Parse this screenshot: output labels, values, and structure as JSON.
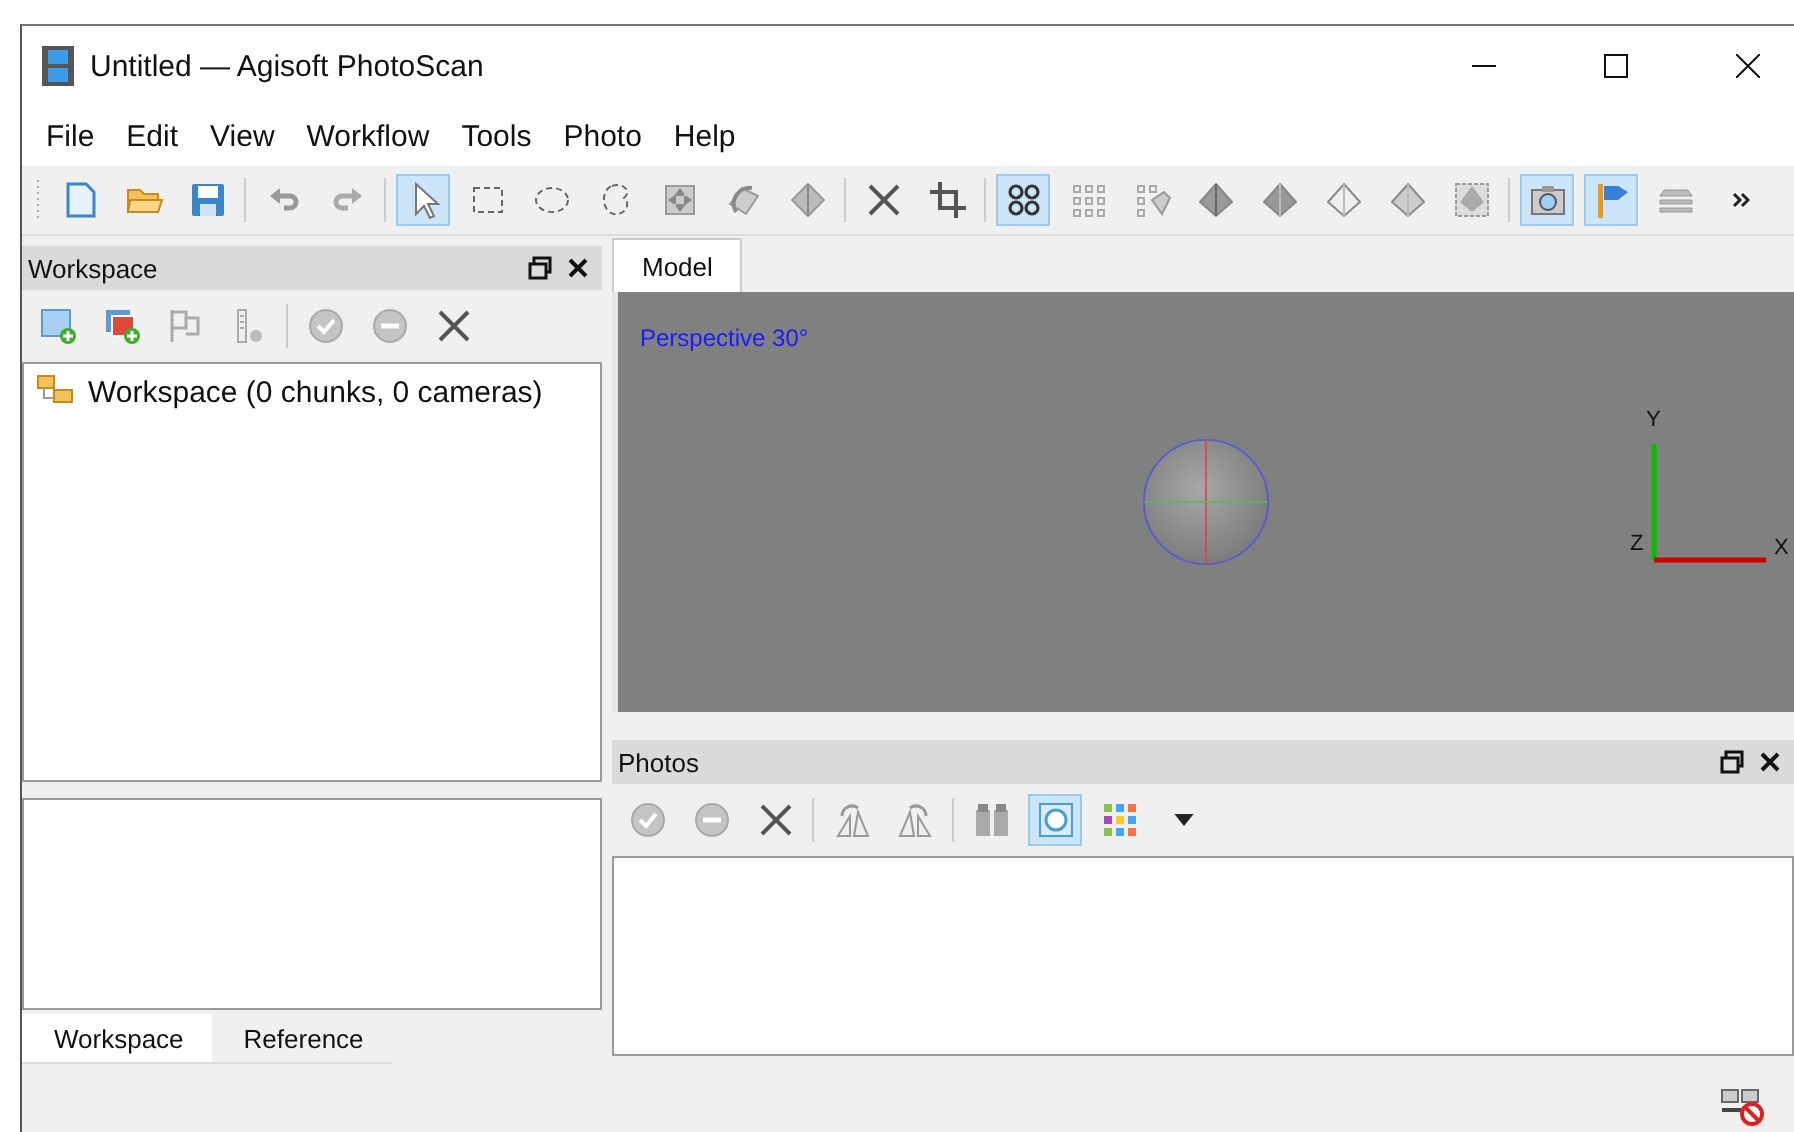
{
  "window": {
    "title": "Untitled — Agisoft PhotoScan"
  },
  "menu": [
    "File",
    "Edit",
    "View",
    "Workflow",
    "Tools",
    "Photo",
    "Help"
  ],
  "toolbar": [
    {
      "kind": "new",
      "selected": false
    },
    {
      "kind": "open",
      "selected": false
    },
    {
      "kind": "save",
      "selected": false
    },
    {
      "kind": "separator"
    },
    {
      "kind": "undo",
      "selected": false
    },
    {
      "kind": "redo",
      "selected": false
    },
    {
      "kind": "separator"
    },
    {
      "kind": "pointer",
      "selected": true
    },
    {
      "kind": "rect-select",
      "selected": false
    },
    {
      "kind": "circle-select",
      "selected": false
    },
    {
      "kind": "free-select",
      "selected": false
    },
    {
      "kind": "move",
      "selected": false
    },
    {
      "kind": "rotate",
      "selected": false
    },
    {
      "kind": "scale",
      "selected": false
    },
    {
      "kind": "separator"
    },
    {
      "kind": "delete",
      "selected": false
    },
    {
      "kind": "crop",
      "selected": false
    },
    {
      "kind": "separator"
    },
    {
      "kind": "points",
      "selected": true
    },
    {
      "kind": "dense",
      "selected": false
    },
    {
      "kind": "tagged",
      "selected": false
    },
    {
      "kind": "solid",
      "selected": false
    },
    {
      "kind": "shaded",
      "selected": false
    },
    {
      "kind": "wire",
      "selected": false
    },
    {
      "kind": "textured",
      "selected": false
    },
    {
      "kind": "tiled",
      "selected": false
    },
    {
      "kind": "separator"
    },
    {
      "kind": "camera",
      "selected": true
    },
    {
      "kind": "flag",
      "selected": true
    },
    {
      "kind": "layers",
      "selected": false
    },
    {
      "kind": "more",
      "selected": false
    }
  ],
  "workspace_panel": {
    "title": "Workspace",
    "toolbar": [
      {
        "kind": "add-photo"
      },
      {
        "kind": "add-chunk"
      },
      {
        "kind": "align"
      },
      {
        "kind": "ruler"
      },
      {
        "kind": "separator"
      },
      {
        "kind": "enable"
      },
      {
        "kind": "disable"
      },
      {
        "kind": "remove"
      }
    ],
    "tree": [
      {
        "label": "Workspace (0 chunks, 0 cameras)"
      }
    ]
  },
  "bottom_tabs": [
    {
      "label": "Workspace",
      "selected": true
    },
    {
      "label": "Reference",
      "selected": false
    }
  ],
  "model_tabs": [
    {
      "label": "Model",
      "selected": true
    }
  ],
  "viewport": {
    "label": "Perspective 30°",
    "axes": {
      "y": "Y",
      "z": "Z",
      "x": "X"
    }
  },
  "photos_panel": {
    "title": "Photos",
    "toolbar": [
      {
        "kind": "enable",
        "selected": false
      },
      {
        "kind": "disable",
        "selected": false
      },
      {
        "kind": "remove",
        "selected": false
      },
      {
        "kind": "separator"
      },
      {
        "kind": "rotate-right",
        "selected": false
      },
      {
        "kind": "rotate-left",
        "selected": false
      },
      {
        "kind": "separator"
      },
      {
        "kind": "binoculars",
        "selected": false
      },
      {
        "kind": "mask",
        "selected": true
      },
      {
        "kind": "grid-view",
        "selected": false
      },
      {
        "kind": "dropdown",
        "selected": false
      }
    ]
  }
}
